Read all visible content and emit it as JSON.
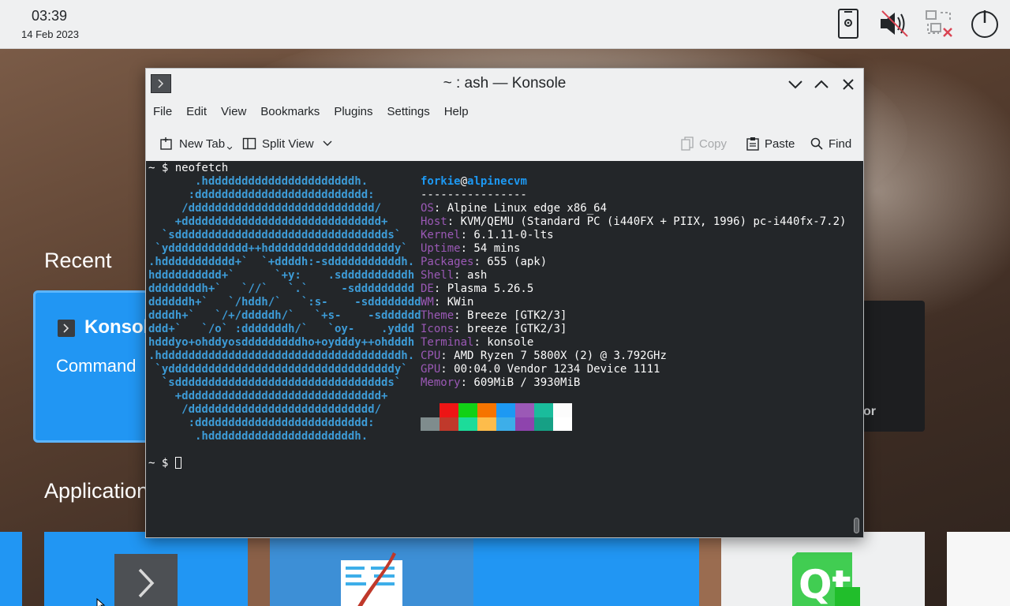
{
  "panel": {
    "time": "03:39",
    "date": "14 Feb 2023",
    "tray": [
      "phone-settings-icon",
      "audio-muted-icon",
      "network-disconnected-icon",
      "power-icon"
    ]
  },
  "overview": {
    "recent_label": "Recent",
    "applications_label": "Applications",
    "recent_card": {
      "title": "Konsole",
      "subtitle": "Command"
    },
    "dark_card_text": "or"
  },
  "window": {
    "title": "~ : ash — Konsole",
    "menu": [
      "File",
      "Edit",
      "View",
      "Bookmarks",
      "Plugins",
      "Settings",
      "Help"
    ],
    "toolbar": {
      "new_tab": "New Tab",
      "split_view": "Split View",
      "copy": "Copy",
      "paste": "Paste",
      "find": "Find"
    }
  },
  "terminal": {
    "command_line": "~ $ neofetch",
    "logo": [
      "       .hddddddddddddddddddddddh.",
      "      :dddddddddddddddddddddddddd:",
      "     /dddddddddddddddddddddddddddd/",
      "    +dddddddddddddddddddddddddddddd+",
      "  `sdddddddddddddddddddddddddddddddds`",
      " `ydddddddddddd++hdddddddddddddddddddy`",
      ".hddddddddddd+`  `+ddddh:-sdddddddddddh.",
      "hdddddddddd+`      `+y:    .sddddddddddh",
      "ddddddddh+`   `//`   `.`     -sddddddddd",
      "ddddddh+`   `/hddh/`   `:s-    -sdddddddd",
      "ddddh+`   `/+/dddddh/`   `+s-    -sdddddd",
      "ddd+`   `/o` :dddddddh/`   `oy-    .yddd",
      "hdddyo+ohddyosdddddddddho+oydddy++ohdddh",
      ".hddddddddddddddddddddddddddddddddddddh.",
      " `yddddddddddddddddddddddddddddddddddy`",
      "  `sdddddddddddddddddddddddddddddddds`",
      "    +dddddddddddddddddddddddddddddd+",
      "     /dddddddddddddddddddddddddddd/",
      "      :dddddddddddddddddddddddddd:",
      "       .hddddddddddddddddddddddh."
    ],
    "user": "forkie",
    "at": "@",
    "host": "alpinecvm",
    "separator": "----------------",
    "info": [
      {
        "key": "OS",
        "value": ": Alpine Linux edge x86_64"
      },
      {
        "key": "Host",
        "value": ": KVM/QEMU (Standard PC (i440FX + PIIX, 1996) pc-i440fx-7.2)"
      },
      {
        "key": "Kernel",
        "value": ": 6.1.11-0-lts"
      },
      {
        "key": "Uptime",
        "value": ": 54 mins"
      },
      {
        "key": "Packages",
        "value": ": 655 (apk)"
      },
      {
        "key": "Shell",
        "value": ": ash"
      },
      {
        "key": "DE",
        "value": ": Plasma 5.26.5"
      },
      {
        "key": "WM",
        "value": ": KWin"
      },
      {
        "key": "Theme",
        "value": ": Breeze [GTK2/3]"
      },
      {
        "key": "Icons",
        "value": ": breeze [GTK2/3]"
      },
      {
        "key": "Terminal",
        "value": ": konsole"
      },
      {
        "key": "CPU",
        "value": ": AMD Ryzen 7 5800X (2) @ 3.792GHz"
      },
      {
        "key": "GPU",
        "value": ": 00:04.0 Vendor 1234 Device 1111"
      },
      {
        "key": "Memory",
        "value": ": 609MiB / 3930MiB"
      }
    ],
    "palette_top": [
      "#232629",
      "#ed1515",
      "#11d116",
      "#f67400",
      "#1d99f3",
      "#9b59b6",
      "#1abc9c",
      "#fcfcfc"
    ],
    "palette_bottom": [
      "#7f8c8d",
      "#c0392b",
      "#1cdc9a",
      "#fdbc4b",
      "#3daee9",
      "#8e44ad",
      "#16a085",
      "#ffffff"
    ],
    "prompt": "~ $ "
  }
}
